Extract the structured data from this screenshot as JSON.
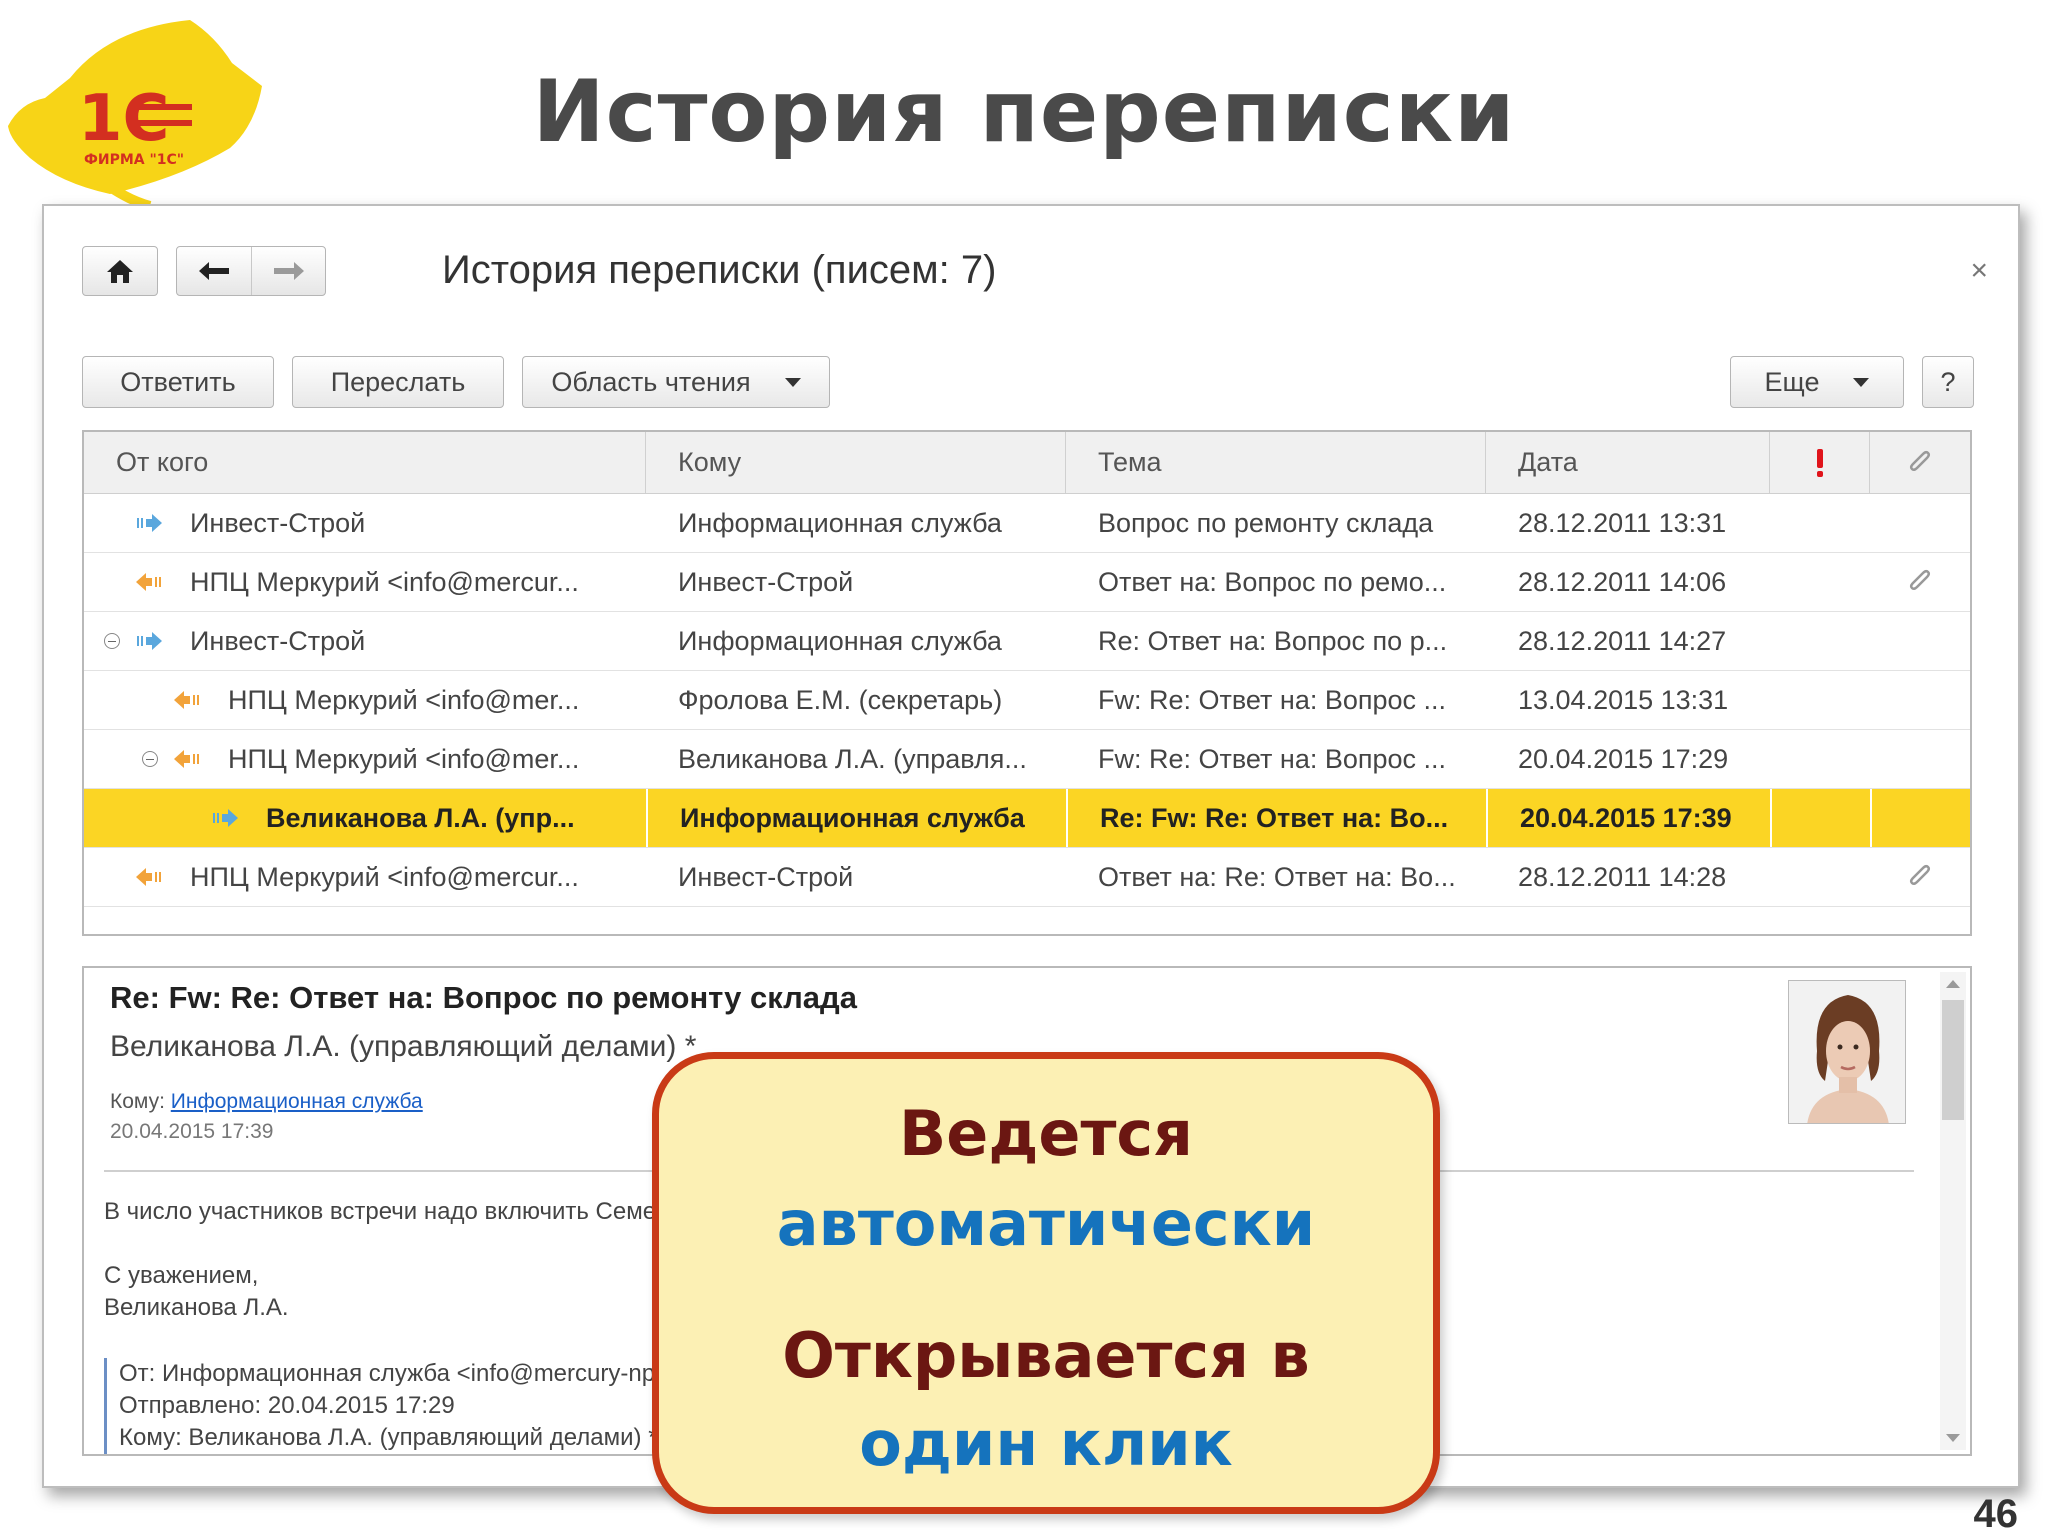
{
  "slide": {
    "title": "История переписки",
    "page_number": "46",
    "logo_text": "1С ФИРМА \"1С\""
  },
  "form": {
    "title": "История переписки (писем: 7)",
    "close_label": "×",
    "nav": {
      "home_icon": "home-icon",
      "back_icon": "arrow-left-icon",
      "forward_icon": "arrow-right-icon"
    },
    "toolbar": {
      "reply": "Ответить",
      "forward": "Переслать",
      "reading_pane": "Область чтения",
      "more": "Еще",
      "help": "?"
    }
  },
  "table": {
    "columns": [
      "От кого",
      "Кому",
      "Тема",
      "Дата"
    ],
    "importance_icon": "exclamation-icon",
    "attachment_icon": "paperclip-icon",
    "rows": [
      {
        "from": "Инвест-Строй",
        "to": "Информационная служба",
        "subject": "Вопрос по ремонту склада",
        "date": "28.12.2011 13:31",
        "direction": "outgoing",
        "level": 0,
        "toggle": false,
        "attach": false,
        "selected": false
      },
      {
        "from": "НПЦ Меркурий <info@mercur...",
        "to": "Инвест-Строй",
        "subject": "Ответ на: Вопрос по ремо...",
        "date": "28.12.2011 14:06",
        "direction": "incoming",
        "level": 0,
        "toggle": false,
        "attach": true,
        "selected": false
      },
      {
        "from": "Инвест-Строй",
        "to": "Информационная служба",
        "subject": "Re: Ответ на: Вопрос по р...",
        "date": "28.12.2011 14:27",
        "direction": "outgoing",
        "level": 0,
        "toggle": true,
        "attach": false,
        "selected": false
      },
      {
        "from": "НПЦ Меркурий <info@mer...",
        "to": "Фролова Е.М. (секретарь)",
        "subject": "Fw: Re: Ответ на: Вопрос ...",
        "date": "13.04.2015 13:31",
        "direction": "incoming",
        "level": 1,
        "toggle": false,
        "attach": false,
        "selected": false
      },
      {
        "from": "НПЦ Меркурий <info@mer...",
        "to": "Великанова Л.А. (управля...",
        "subject": "Fw: Re: Ответ на: Вопрос ...",
        "date": "20.04.2015 17:29",
        "direction": "incoming",
        "level": 1,
        "toggle": true,
        "attach": false,
        "selected": false
      },
      {
        "from": "Великанова Л.А. (упр...",
        "to": "Информационная служба",
        "subject": "Re: Fw: Re: Ответ на: Во...",
        "date": "20.04.2015 17:39",
        "direction": "outgoing",
        "level": 2,
        "toggle": false,
        "attach": false,
        "selected": true
      },
      {
        "from": "НПЦ Меркурий <info@mercur...",
        "to": "Инвест-Строй",
        "subject": "Ответ на: Re: Ответ на: Во...",
        "date": "28.12.2011 14:28",
        "direction": "incoming",
        "level": 0,
        "toggle": false,
        "attach": true,
        "selected": false
      }
    ]
  },
  "preview": {
    "subject": "Re: Fw: Re: Ответ на: Вопрос по ремонту склада",
    "from": "Великанова Л.А. (управляющий делами) *",
    "to_label": "Кому:",
    "to_link": "Информационная служба",
    "date": "20.04.2015 17:39",
    "body_line1": "В число участников встречи надо включить Семенова О.М.",
    "body_line2": "С уважением,",
    "body_line3": "Великанова Л.А.",
    "quote_line1": "От: Информационная служба <info@mercury-npo.ru>",
    "quote_line2": "Отправлено: 20.04.2015 17:29",
    "quote_line3": "Кому: Великанова Л.А. (управляющий делами) *"
  },
  "callout": {
    "line1": "Ведется",
    "line2": "автоматически",
    "line3": "Открывается в",
    "line4": "один клик"
  },
  "colors": {
    "selected_row": "#fbd524",
    "callout_border": "#c93a16",
    "callout_bg": "#fcf0b4",
    "callout_dark": "#6b1712",
    "callout_blue": "#1573bd",
    "incoming_arrow": "#f2a33a",
    "outgoing_arrow": "#5aa7dd",
    "importance": "#e0141b"
  }
}
